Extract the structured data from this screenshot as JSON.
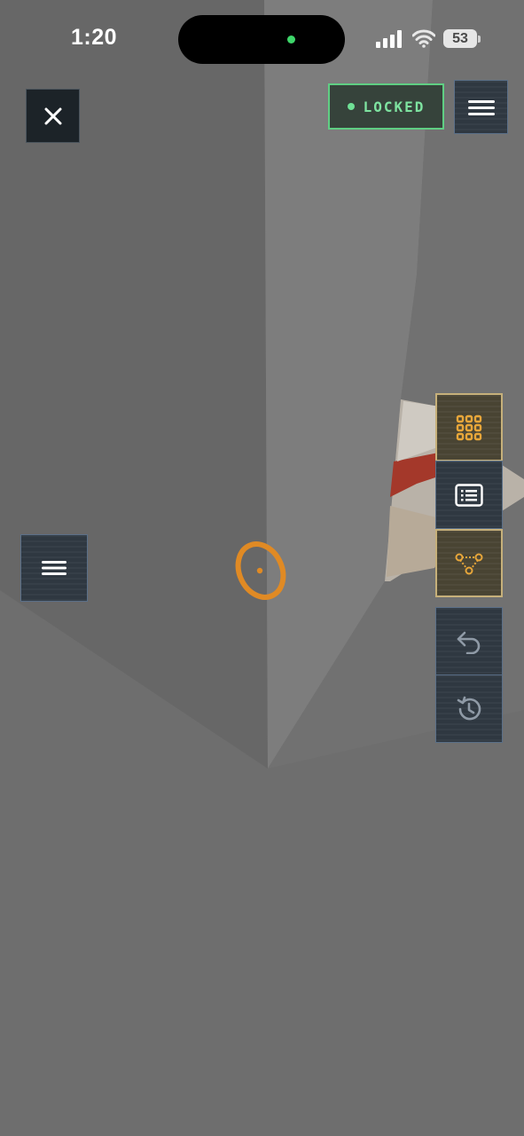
{
  "status_bar": {
    "time": "1:20",
    "battery": "53",
    "camera_indicator_color": "#3ed66a"
  },
  "top_bar": {
    "close_icon": "close-icon",
    "lock_status": "LOCKED",
    "lock_color": "#5fcf83",
    "menu_icon": "hamburger-menu-icon"
  },
  "side_menu": {
    "icon": "hamburger-menu-icon"
  },
  "toolbar": {
    "tools": [
      {
        "icon": "grid-icon",
        "active": true,
        "color": "#e7a63a"
      },
      {
        "icon": "list-icon",
        "active": false
      },
      {
        "icon": "node-graph-icon",
        "active": true,
        "color": "#e7a63a"
      }
    ],
    "history": [
      {
        "icon": "undo-icon"
      },
      {
        "icon": "history-icon"
      }
    ]
  },
  "reticle": {
    "icon": "target-reticle-icon",
    "color": "#e08a24"
  }
}
